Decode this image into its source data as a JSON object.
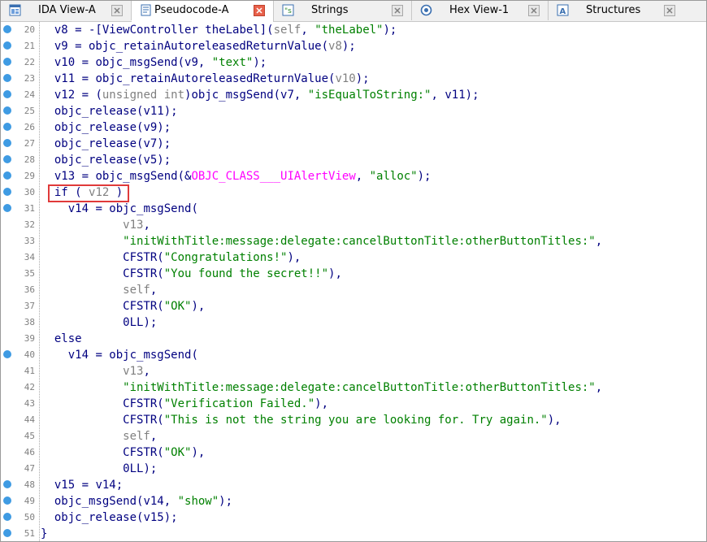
{
  "tabs": [
    {
      "label": "IDA View-A",
      "icon": "ida-view-icon",
      "active": false
    },
    {
      "label": "Pseudocode-A",
      "icon": "pseudocode-icon",
      "active": true
    },
    {
      "label": "Strings",
      "icon": "strings-icon",
      "active": false
    },
    {
      "label": "Hex View-1",
      "icon": "hex-view-icon",
      "active": false
    },
    {
      "label": "Structures",
      "icon": "structures-icon",
      "active": false
    }
  ],
  "colors": {
    "variable": "#000080",
    "string": "#008000",
    "gray": "#808080",
    "class_ref": "#ff00ff",
    "breakpoint": "#3f9be3",
    "highlight_border": "#e03a3a",
    "active_close": "#e8604a"
  },
  "highlighted_line": 30,
  "lines": [
    {
      "num": "20",
      "bp": true,
      "segs": [
        [
          "v",
          "  v8"
        ],
        [
          "p",
          " = -["
        ],
        [
          "v",
          "ViewController theLabel"
        ],
        [
          "p",
          "]("
        ],
        [
          "g",
          "self"
        ],
        [
          "p",
          ", "
        ],
        [
          "s",
          "\"theLabel\""
        ],
        [
          "p",
          ");"
        ]
      ]
    },
    {
      "num": "21",
      "bp": true,
      "segs": [
        [
          "v",
          "  v9"
        ],
        [
          "p",
          " = objc_retainAutoreleasedReturnValue("
        ],
        [
          "g",
          "v8"
        ],
        [
          "p",
          ");"
        ]
      ]
    },
    {
      "num": "22",
      "bp": true,
      "segs": [
        [
          "v",
          "  v10"
        ],
        [
          "p",
          " = objc_msgSend("
        ],
        [
          "v",
          "v9"
        ],
        [
          "p",
          ", "
        ],
        [
          "s",
          "\"text\""
        ],
        [
          "p",
          ");"
        ]
      ]
    },
    {
      "num": "23",
      "bp": true,
      "segs": [
        [
          "v",
          "  v11"
        ],
        [
          "p",
          " = objc_retainAutoreleasedReturnValue("
        ],
        [
          "g",
          "v10"
        ],
        [
          "p",
          ");"
        ]
      ]
    },
    {
      "num": "24",
      "bp": true,
      "segs": [
        [
          "v",
          "  v12"
        ],
        [
          "p",
          " = ("
        ],
        [
          "g",
          "unsigned int"
        ],
        [
          "p",
          ")objc_msgSend("
        ],
        [
          "v",
          "v7"
        ],
        [
          "p",
          ", "
        ],
        [
          "s",
          "\"isEqualToString:\""
        ],
        [
          "p",
          ", "
        ],
        [
          "v",
          "v11"
        ],
        [
          "p",
          ");"
        ]
      ]
    },
    {
      "num": "25",
      "bp": true,
      "segs": [
        [
          "p",
          "  objc_release("
        ],
        [
          "v",
          "v11"
        ],
        [
          "p",
          ");"
        ]
      ]
    },
    {
      "num": "26",
      "bp": true,
      "segs": [
        [
          "p",
          "  objc_release("
        ],
        [
          "v",
          "v9"
        ],
        [
          "p",
          ");"
        ]
      ]
    },
    {
      "num": "27",
      "bp": true,
      "segs": [
        [
          "p",
          "  objc_release("
        ],
        [
          "v",
          "v7"
        ],
        [
          "p",
          ");"
        ]
      ]
    },
    {
      "num": "28",
      "bp": true,
      "segs": [
        [
          "p",
          "  objc_release("
        ],
        [
          "v",
          "v5"
        ],
        [
          "p",
          ");"
        ]
      ]
    },
    {
      "num": "29",
      "bp": true,
      "segs": [
        [
          "v",
          "  v13"
        ],
        [
          "p",
          " = objc_msgSend(&"
        ],
        [
          "m",
          "OBJC_CLASS___UIAlertView"
        ],
        [
          "p",
          ", "
        ],
        [
          "s",
          "\"alloc\""
        ],
        [
          "p",
          ");"
        ]
      ]
    },
    {
      "num": "30",
      "bp": true,
      "segs": [
        [
          "k",
          "  if"
        ],
        [
          "p",
          " ( "
        ],
        [
          "g",
          "v12"
        ],
        [
          "p",
          " )"
        ]
      ]
    },
    {
      "num": "31",
      "bp": true,
      "segs": [
        [
          "v",
          "    v14"
        ],
        [
          "p",
          " = objc_msgSend("
        ]
      ]
    },
    {
      "num": "32",
      "bp": false,
      "segs": [
        [
          "g",
          "            v13"
        ],
        [
          "p",
          ","
        ]
      ]
    },
    {
      "num": "33",
      "bp": false,
      "segs": [
        [
          "s",
          "            \"initWithTitle:message:delegate:cancelButtonTitle:otherButtonTitles:\""
        ],
        [
          "p",
          ","
        ]
      ]
    },
    {
      "num": "34",
      "bp": false,
      "segs": [
        [
          "p",
          "            CFSTR("
        ],
        [
          "s",
          "\"Congratulations!\""
        ],
        [
          "p",
          "),"
        ]
      ]
    },
    {
      "num": "35",
      "bp": false,
      "segs": [
        [
          "p",
          "            CFSTR("
        ],
        [
          "s",
          "\"You found the secret!!\""
        ],
        [
          "p",
          "),"
        ]
      ]
    },
    {
      "num": "36",
      "bp": false,
      "segs": [
        [
          "g",
          "            self"
        ],
        [
          "p",
          ","
        ]
      ]
    },
    {
      "num": "37",
      "bp": false,
      "segs": [
        [
          "p",
          "            CFSTR("
        ],
        [
          "s",
          "\"OK\""
        ],
        [
          "p",
          "),"
        ]
      ]
    },
    {
      "num": "38",
      "bp": false,
      "segs": [
        [
          "n",
          "            0LL"
        ],
        [
          "p",
          ");"
        ]
      ]
    },
    {
      "num": "39",
      "bp": false,
      "segs": [
        [
          "k",
          "  else"
        ]
      ]
    },
    {
      "num": "40",
      "bp": true,
      "segs": [
        [
          "v",
          "    v14"
        ],
        [
          "p",
          " = objc_msgSend("
        ]
      ]
    },
    {
      "num": "41",
      "bp": false,
      "segs": [
        [
          "g",
          "            v13"
        ],
        [
          "p",
          ","
        ]
      ]
    },
    {
      "num": "42",
      "bp": false,
      "segs": [
        [
          "s",
          "            \"initWithTitle:message:delegate:cancelButtonTitle:otherButtonTitles:\""
        ],
        [
          "p",
          ","
        ]
      ]
    },
    {
      "num": "43",
      "bp": false,
      "segs": [
        [
          "p",
          "            CFSTR("
        ],
        [
          "s",
          "\"Verification Failed.\""
        ],
        [
          "p",
          "),"
        ]
      ]
    },
    {
      "num": "44",
      "bp": false,
      "segs": [
        [
          "p",
          "            CFSTR("
        ],
        [
          "s",
          "\"This is not the string you are looking for. Try again.\""
        ],
        [
          "p",
          "),"
        ]
      ]
    },
    {
      "num": "45",
      "bp": false,
      "segs": [
        [
          "g",
          "            self"
        ],
        [
          "p",
          ","
        ]
      ]
    },
    {
      "num": "46",
      "bp": false,
      "segs": [
        [
          "p",
          "            CFSTR("
        ],
        [
          "s",
          "\"OK\""
        ],
        [
          "p",
          "),"
        ]
      ]
    },
    {
      "num": "47",
      "bp": false,
      "segs": [
        [
          "n",
          "            0LL"
        ],
        [
          "p",
          ");"
        ]
      ]
    },
    {
      "num": "48",
      "bp": true,
      "segs": [
        [
          "v",
          "  v15"
        ],
        [
          "p",
          " = "
        ],
        [
          "v",
          "v14"
        ],
        [
          "p",
          ";"
        ]
      ]
    },
    {
      "num": "49",
      "bp": true,
      "segs": [
        [
          "p",
          "  objc_msgSend("
        ],
        [
          "v",
          "v14"
        ],
        [
          "p",
          ", "
        ],
        [
          "s",
          "\"show\""
        ],
        [
          "p",
          ");"
        ]
      ]
    },
    {
      "num": "50",
      "bp": true,
      "segs": [
        [
          "p",
          "  objc_release("
        ],
        [
          "v",
          "v15"
        ],
        [
          "p",
          ");"
        ]
      ]
    },
    {
      "num": "51",
      "bp": true,
      "segs": [
        [
          "p",
          "}"
        ]
      ]
    }
  ]
}
